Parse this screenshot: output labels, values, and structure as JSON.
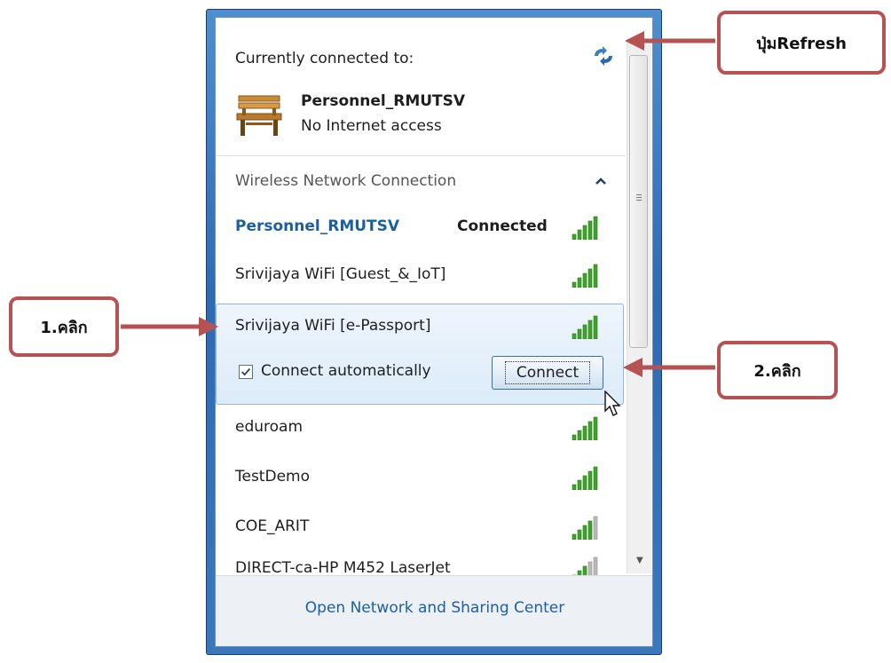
{
  "header": {
    "connected_label": "Currently connected to:",
    "current_network": "Personnel_RMUTSV",
    "current_status": "No Internet access"
  },
  "section": {
    "title": "Wireless Network Connection"
  },
  "networks": [
    {
      "name": "Personnel_RMUTSV",
      "status": "Connected",
      "signal_bars": 5
    },
    {
      "name": "Srivijaya WiFi [Guest_&_IoT]",
      "signal_bars": 5
    },
    {
      "name": "Srivijaya WiFi [e-Passport]",
      "signal_bars": 5,
      "expanded": true
    },
    {
      "name": "eduroam",
      "signal_bars": 5
    },
    {
      "name": "TestDemo",
      "signal_bars": 5
    },
    {
      "name": "COE_ARIT",
      "signal_bars": 4
    },
    {
      "name": "DIRECT-ca-HP M452 LaserJet",
      "signal_bars": 3
    }
  ],
  "expanded_panel": {
    "connect_auto_label": "Connect automatically",
    "connect_auto_checked": true,
    "connect_button": "Connect"
  },
  "footer": {
    "link": "Open Network and Sharing Center"
  },
  "annotations": {
    "refresh": "ปุ่มRefresh",
    "step1": "1.คลิก",
    "step2": "2.คลิก"
  },
  "colors": {
    "frame_blue": "#3a78bd",
    "link_blue": "#1d5f9e",
    "signal_green": "#3fa22a",
    "callout_red": "#b65252"
  }
}
